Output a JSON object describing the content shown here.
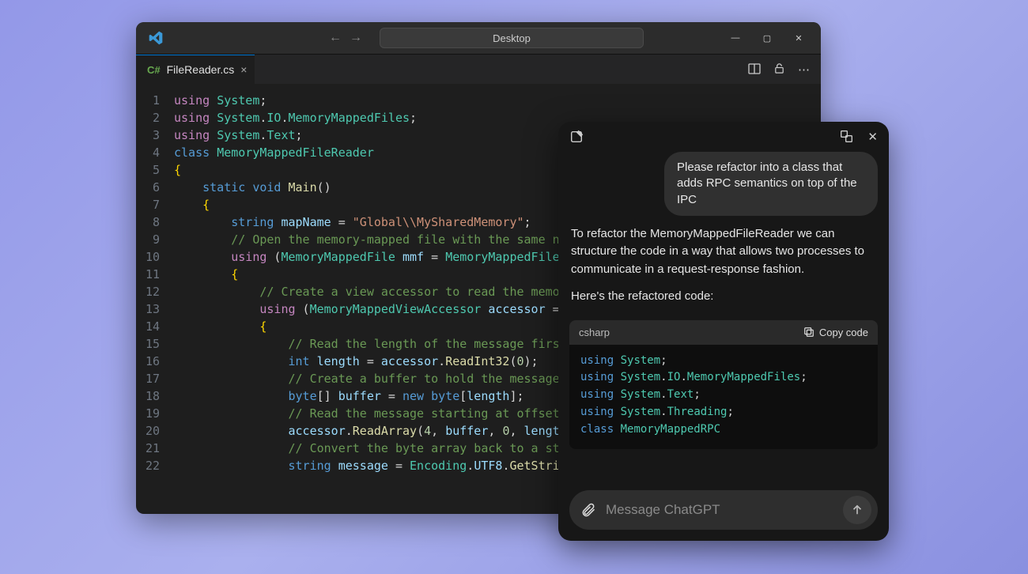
{
  "vscode": {
    "search_label": "Desktop",
    "tab": {
      "filename": "FileReader.cs"
    },
    "lines": [
      [
        [
          "kw",
          "using"
        ],
        [
          "punc",
          " "
        ],
        [
          "type",
          "System"
        ],
        [
          "punc",
          ";"
        ]
      ],
      [
        [
          "kw",
          "using"
        ],
        [
          "punc",
          " "
        ],
        [
          "type",
          "System"
        ],
        [
          "punc",
          "."
        ],
        [
          "type",
          "IO"
        ],
        [
          "punc",
          "."
        ],
        [
          "type",
          "MemoryMappedFiles"
        ],
        [
          "punc",
          ";"
        ]
      ],
      [
        [
          "kw",
          "using"
        ],
        [
          "punc",
          " "
        ],
        [
          "type",
          "System"
        ],
        [
          "punc",
          "."
        ],
        [
          "type",
          "Text"
        ],
        [
          "punc",
          ";"
        ]
      ],
      [
        [
          "kw2",
          "class"
        ],
        [
          "punc",
          " "
        ],
        [
          "type",
          "MemoryMappedFileReader"
        ]
      ],
      [
        [
          "brace",
          "{"
        ]
      ],
      [
        [
          "punc",
          "    "
        ],
        [
          "kw2",
          "static"
        ],
        [
          "punc",
          " "
        ],
        [
          "kw2",
          "void"
        ],
        [
          "punc",
          " "
        ],
        [
          "fn",
          "Main"
        ],
        [
          "punc",
          "()"
        ]
      ],
      [
        [
          "punc",
          "    "
        ],
        [
          "brace",
          "{"
        ]
      ],
      [
        [
          "punc",
          "        "
        ],
        [
          "kw2",
          "string"
        ],
        [
          "punc",
          " "
        ],
        [
          "var",
          "mapName"
        ],
        [
          "punc",
          " = "
        ],
        [
          "str",
          "\"Global\\\\MySharedMemory\""
        ],
        [
          "punc",
          ";"
        ]
      ],
      [
        [
          "punc",
          "        "
        ],
        [
          "cmt",
          "// Open the memory-mapped file with the same na"
        ]
      ],
      [
        [
          "punc",
          "        "
        ],
        [
          "kw",
          "using"
        ],
        [
          "punc",
          " ("
        ],
        [
          "type",
          "MemoryMappedFile"
        ],
        [
          "punc",
          " "
        ],
        [
          "var",
          "mmf"
        ],
        [
          "punc",
          " = "
        ],
        [
          "type",
          "MemoryMappedFile"
        ],
        [
          "punc",
          "."
        ]
      ],
      [
        [
          "punc",
          "        "
        ],
        [
          "brace",
          "{"
        ]
      ],
      [
        [
          "punc",
          "            "
        ],
        [
          "cmt",
          "// Create a view accessor to read the memor"
        ]
      ],
      [
        [
          "punc",
          "            "
        ],
        [
          "kw",
          "using"
        ],
        [
          "punc",
          " ("
        ],
        [
          "type",
          "MemoryMappedViewAccessor"
        ],
        [
          "punc",
          " "
        ],
        [
          "var",
          "accessor"
        ],
        [
          "punc",
          " = "
        ]
      ],
      [
        [
          "punc",
          "            "
        ],
        [
          "brace",
          "{"
        ]
      ],
      [
        [
          "punc",
          "                "
        ],
        [
          "cmt",
          "// Read the length of the message first"
        ]
      ],
      [
        [
          "punc",
          "                "
        ],
        [
          "kw2",
          "int"
        ],
        [
          "punc",
          " "
        ],
        [
          "var",
          "length"
        ],
        [
          "punc",
          " = "
        ],
        [
          "var",
          "accessor"
        ],
        [
          "punc",
          "."
        ],
        [
          "fn",
          "ReadInt32"
        ],
        [
          "punc",
          "("
        ],
        [
          "num",
          "0"
        ],
        [
          "punc",
          ");"
        ]
      ],
      [
        [
          "punc",
          "                "
        ],
        [
          "cmt",
          "// Create a buffer to hold the message"
        ]
      ],
      [
        [
          "punc",
          "                "
        ],
        [
          "kw2",
          "byte"
        ],
        [
          "punc",
          "[] "
        ],
        [
          "var",
          "buffer"
        ],
        [
          "punc",
          " = "
        ],
        [
          "kw2",
          "new"
        ],
        [
          "punc",
          " "
        ],
        [
          "kw2",
          "byte"
        ],
        [
          "punc",
          "["
        ],
        [
          "var",
          "length"
        ],
        [
          "punc",
          "];"
        ]
      ],
      [
        [
          "punc",
          "                "
        ],
        [
          "cmt",
          "// Read the message starting at offset "
        ]
      ],
      [
        [
          "punc",
          "                "
        ],
        [
          "var",
          "accessor"
        ],
        [
          "punc",
          "."
        ],
        [
          "fn",
          "ReadArray"
        ],
        [
          "punc",
          "("
        ],
        [
          "num",
          "4"
        ],
        [
          "punc",
          ", "
        ],
        [
          "var",
          "buffer"
        ],
        [
          "punc",
          ", "
        ],
        [
          "num",
          "0"
        ],
        [
          "punc",
          ", "
        ],
        [
          "var",
          "length"
        ]
      ],
      [
        [
          "punc",
          "                "
        ],
        [
          "cmt",
          "// Convert the byte array back to a str"
        ]
      ],
      [
        [
          "punc",
          "                "
        ],
        [
          "kw2",
          "string"
        ],
        [
          "punc",
          " "
        ],
        [
          "var",
          "message"
        ],
        [
          "punc",
          " = "
        ],
        [
          "type",
          "Encoding"
        ],
        [
          "punc",
          "."
        ],
        [
          "var",
          "UTF8"
        ],
        [
          "punc",
          "."
        ],
        [
          "fn",
          "GetStrin"
        ]
      ]
    ]
  },
  "chat": {
    "user_message": "Please refactor into a class that adds RPC semantics on top of the IPC",
    "assistant_p1": "To refactor the MemoryMappedFileReader we can structure the code in a way that allows two processes to communicate in a request-response fashion.",
    "assistant_p2": "Here's the refactored code:",
    "code_lang": "csharp",
    "copy_label": "Copy code",
    "code_lines": [
      [
        [
          "kw2",
          "using"
        ],
        [
          "punc",
          " "
        ],
        [
          "type",
          "System"
        ],
        [
          "punc",
          ";"
        ]
      ],
      [
        [
          "kw2",
          "using"
        ],
        [
          "punc",
          " "
        ],
        [
          "type",
          "System"
        ],
        [
          "punc",
          "."
        ],
        [
          "type",
          "IO"
        ],
        [
          "punc",
          "."
        ],
        [
          "type",
          "MemoryMappedFiles"
        ],
        [
          "punc",
          ";"
        ]
      ],
      [
        [
          "kw2",
          "using"
        ],
        [
          "punc",
          " "
        ],
        [
          "type",
          "System"
        ],
        [
          "punc",
          "."
        ],
        [
          "type",
          "Text"
        ],
        [
          "punc",
          ";"
        ]
      ],
      [
        [
          "kw2",
          "using"
        ],
        [
          "punc",
          " "
        ],
        [
          "type",
          "System"
        ],
        [
          "punc",
          "."
        ],
        [
          "type",
          "Threading"
        ],
        [
          "punc",
          ";"
        ]
      ],
      [
        [
          "punc",
          ""
        ]
      ],
      [
        [
          "kw2",
          "class"
        ],
        [
          "punc",
          " "
        ],
        [
          "type",
          "MemoryMappedRPC"
        ]
      ]
    ],
    "input_placeholder": "Message ChatGPT"
  }
}
